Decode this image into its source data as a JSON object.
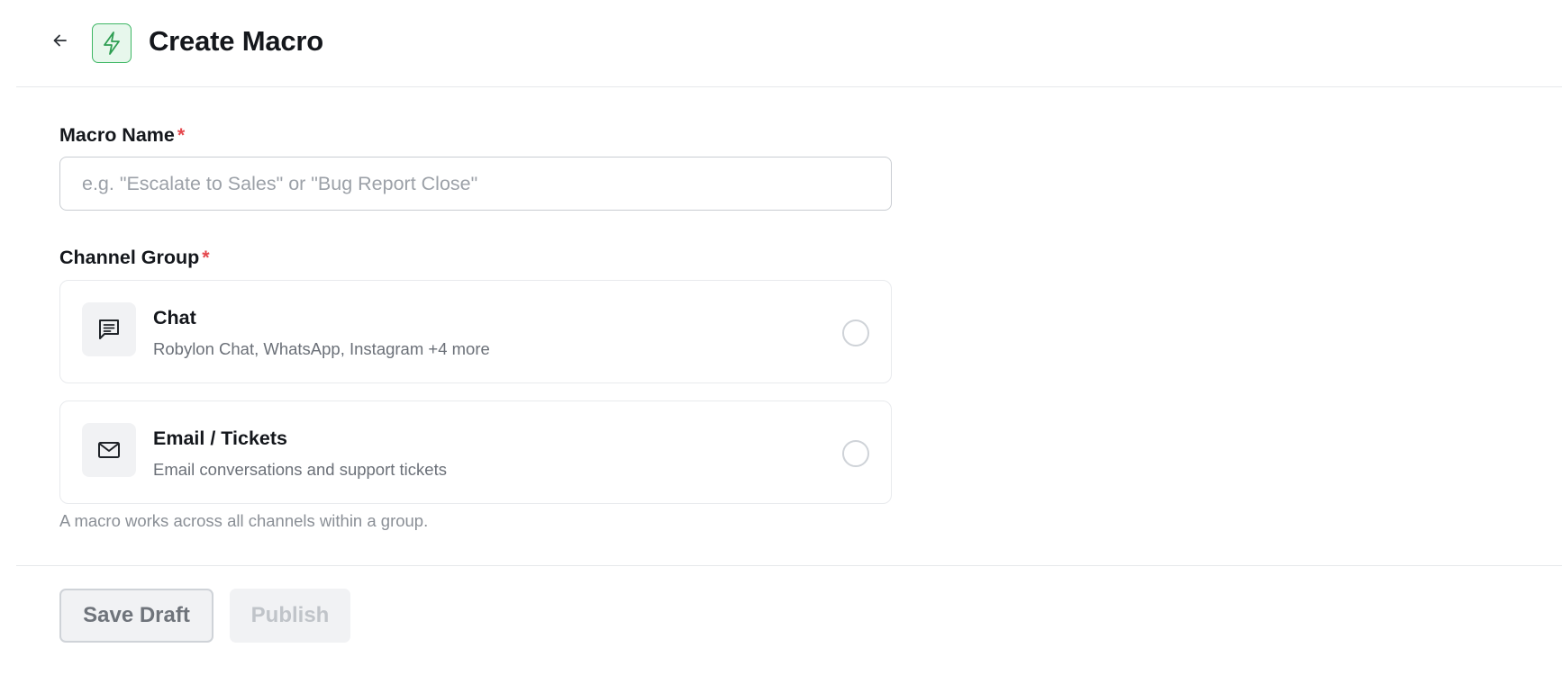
{
  "header": {
    "title": "Create Macro",
    "back_icon": "arrow-left-icon",
    "badge_icon": "lightning-bolt-icon",
    "badge_color": "#3fb765"
  },
  "form": {
    "macro_name": {
      "label": "Macro Name",
      "required_marker": "*",
      "value": "",
      "placeholder": "e.g. \"Escalate to Sales\" or \"Bug Report Close\""
    },
    "channel_group": {
      "label": "Channel Group",
      "required_marker": "*",
      "options": [
        {
          "title": "Chat",
          "description": "Robylon Chat, WhatsApp, Instagram +4 more",
          "icon": "chat-message-icon",
          "selected": false
        },
        {
          "title": "Email / Tickets",
          "description": "Email conversations and support tickets",
          "icon": "mail-envelope-icon",
          "selected": false
        }
      ],
      "helper": "A macro works across all channels within a group."
    }
  },
  "footer": {
    "save_draft_label": "Save Draft",
    "publish_label": "Publish",
    "publish_disabled": true
  },
  "colors": {
    "required": "#e5484d",
    "accent_green": "#3fb765"
  }
}
